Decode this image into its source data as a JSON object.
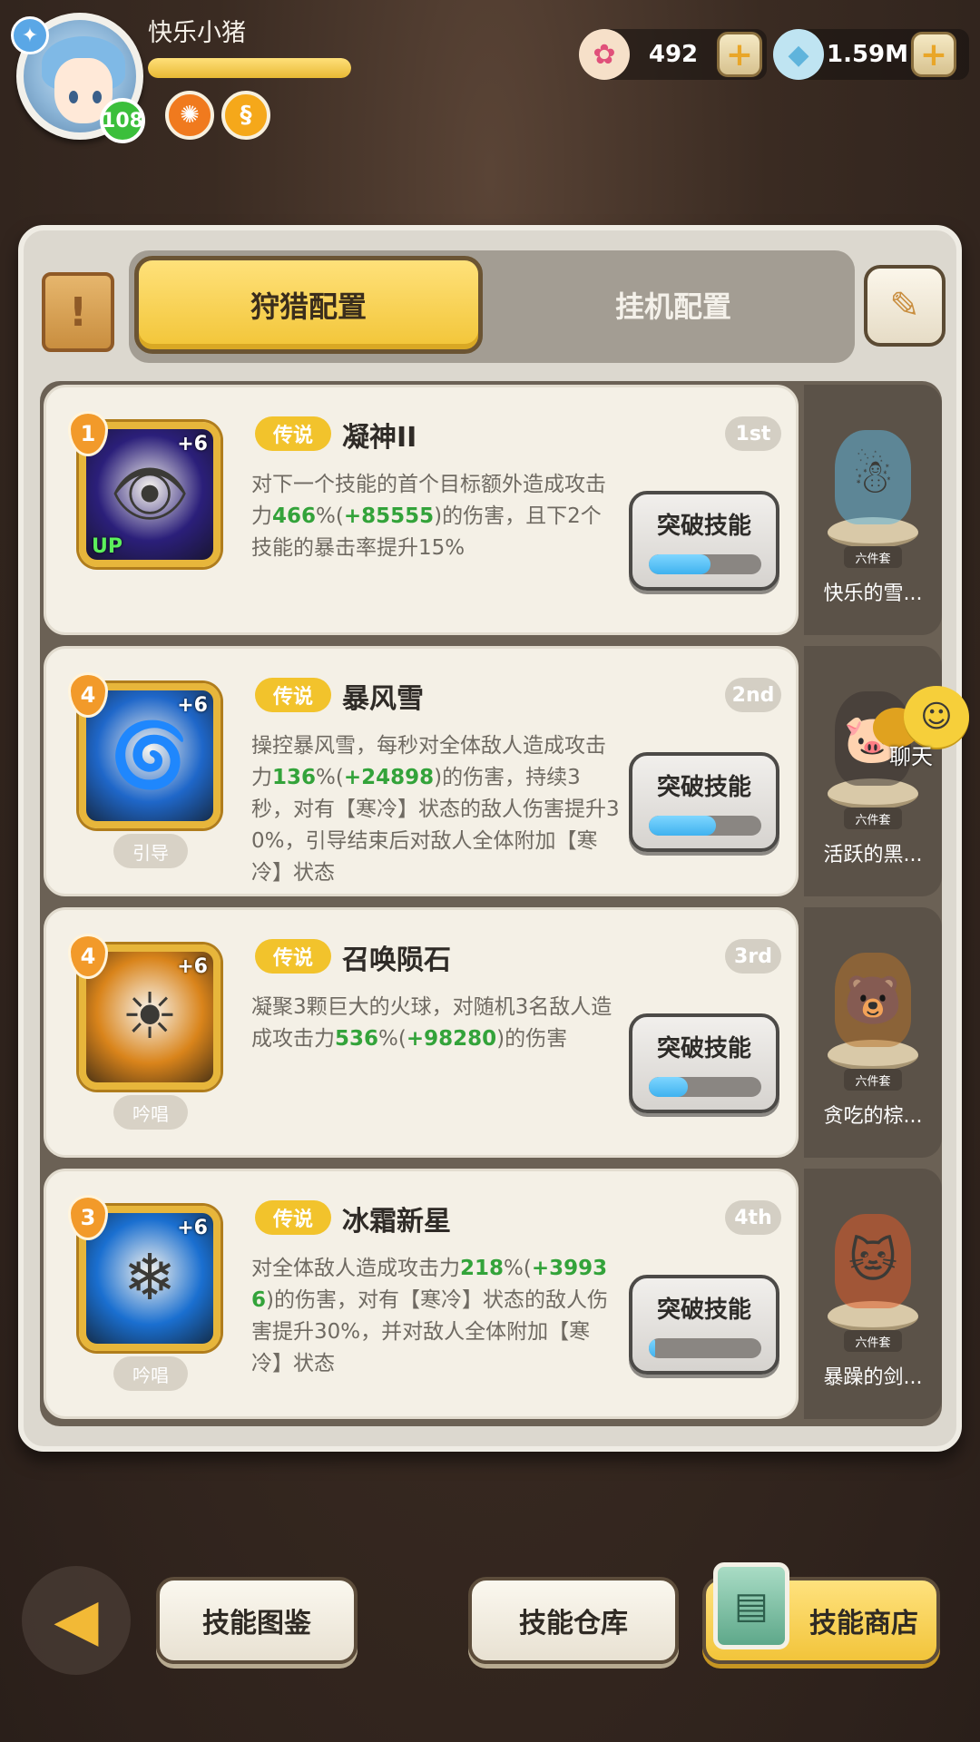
{
  "player": {
    "name": "快乐小猪",
    "level": "108",
    "exp_progress": 1.0
  },
  "currencies": [
    {
      "icon": "shell-gem-icon",
      "value": "492"
    },
    {
      "icon": "crystal-icon",
      "value": "1.59M"
    }
  ],
  "tabs": {
    "hunt": "狩猎配置",
    "idle": "挂机配置"
  },
  "skills": [
    {
      "slot": "1",
      "rarity": "传说",
      "name": "凝神II",
      "rank": "1st",
      "plus": "+6",
      "up_label": "UP",
      "cast_type": "",
      "desc_parts": [
        {
          "t": "对下一个技能的首个目标额外造成攻击力",
          "g": false
        },
        {
          "t": "466",
          "g": true
        },
        {
          "t": "%(",
          "g": false
        },
        {
          "t": "+85555",
          "g": true
        },
        {
          "t": ")的伤害，且下2个技能的暴击率提升15%",
          "g": false
        }
      ],
      "button": "突破技能",
      "progress": 0.55,
      "pet_name": "快乐的雪...",
      "pet_tag": "六件套",
      "icon_color": "#2b1f7a",
      "glyph": "👁"
    },
    {
      "slot": "4",
      "rarity": "传说",
      "name": "暴风雪",
      "rank": "2nd",
      "plus": "+6",
      "up_label": "",
      "cast_type": "引导",
      "desc_parts": [
        {
          "t": "操控暴风雪，每秒对全体敌人造成攻击力",
          "g": false
        },
        {
          "t": "136",
          "g": true
        },
        {
          "t": "%(",
          "g": false
        },
        {
          "t": "+24898",
          "g": true
        },
        {
          "t": ")的伤害，持续3秒，对有【寒冷】状态的敌人伤害提升30%，引导结束后对敌人全体附加【寒冷】状态",
          "g": false
        }
      ],
      "button": "突破技能",
      "progress": 0.6,
      "pet_name": "活跃的黑...",
      "pet_tag": "六件套",
      "icon_color": "#1f67c9",
      "glyph": "🌀"
    },
    {
      "slot": "4",
      "rarity": "传说",
      "name": "召唤陨石",
      "rank": "3rd",
      "plus": "+6",
      "up_label": "",
      "cast_type": "吟唱",
      "desc_parts": [
        {
          "t": "凝聚3颗巨大的火球，对随机3名敌人造成攻击力",
          "g": false
        },
        {
          "t": "536",
          "g": true
        },
        {
          "t": "%(",
          "g": false
        },
        {
          "t": "+98280",
          "g": true
        },
        {
          "t": ")的伤害",
          "g": false
        }
      ],
      "button": "突破技能",
      "progress": 0.35,
      "pet_name": "贪吃的棕...",
      "pet_tag": "六件套",
      "icon_color": "#d9841b",
      "glyph": "☀"
    },
    {
      "slot": "3",
      "rarity": "传说",
      "name": "冰霜新星",
      "rank": "4th",
      "plus": "+6",
      "up_label": "",
      "cast_type": "吟唱",
      "desc_parts": [
        {
          "t": "对全体敌人造成攻击力",
          "g": false
        },
        {
          "t": "218",
          "g": true
        },
        {
          "t": "%(",
          "g": false
        },
        {
          "t": "+39936",
          "g": true
        },
        {
          "t": ")的伤害，对有【寒冷】状态的敌人伤害提升30%，并对敌人全体附加【寒冷】状态",
          "g": false
        }
      ],
      "button": "突破技能",
      "progress": 0.06,
      "pet_name": "暴躁的剑...",
      "pet_tag": "六件套",
      "icon_color": "#1a6fd0",
      "glyph": "❄"
    }
  ],
  "chat": {
    "label": "聊天"
  },
  "bottom": {
    "codex": "技能图鉴",
    "storage": "技能仓库",
    "shop": "技能商店"
  }
}
